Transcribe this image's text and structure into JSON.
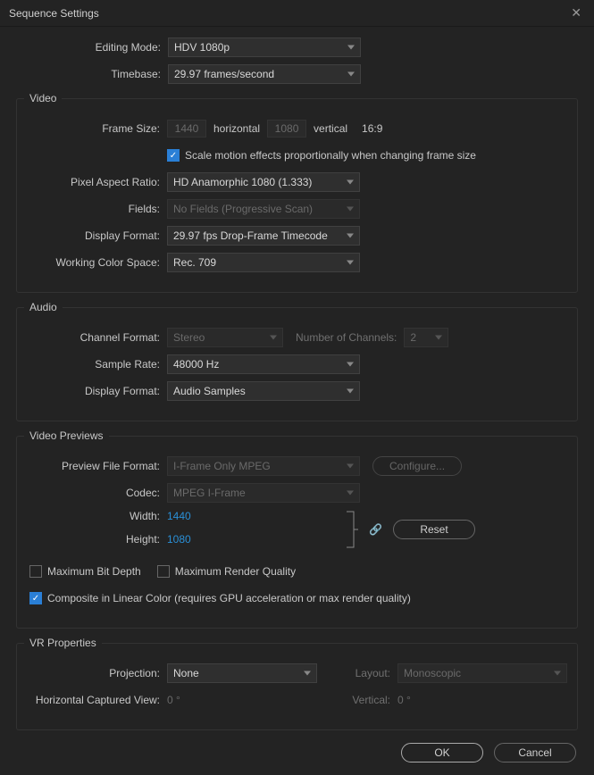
{
  "title": "Sequence Settings",
  "close_glyph": "✕",
  "top": {
    "editing_mode_label": "Editing Mode:",
    "editing_mode_value": "HDV 1080p",
    "timebase_label": "Timebase:",
    "timebase_value": "29.97  frames/second"
  },
  "video": {
    "section_title": "Video",
    "frame_size_label": "Frame Size:",
    "frame_w": "1440",
    "horizontal": "horizontal",
    "frame_h": "1080",
    "vertical": "vertical",
    "aspect": "16:9",
    "scale_motion": "Scale motion effects proportionally when changing frame size",
    "par_label": "Pixel Aspect Ratio:",
    "par_value": "HD Anamorphic 1080 (1.333)",
    "fields_label": "Fields:",
    "fields_value": "No Fields (Progressive Scan)",
    "display_format_label": "Display Format:",
    "display_format_value": "29.97 fps Drop-Frame Timecode",
    "wcs_label": "Working Color Space:",
    "wcs_value": "Rec. 709"
  },
  "audio": {
    "section_title": "Audio",
    "channel_format_label": "Channel Format:",
    "channel_format_value": "Stereo",
    "num_channels_label": "Number of Channels:",
    "num_channels_value": "2",
    "sample_rate_label": "Sample Rate:",
    "sample_rate_value": "48000 Hz",
    "display_format_label": "Display Format:",
    "display_format_value": "Audio Samples"
  },
  "previews": {
    "section_title": "Video Previews",
    "pff_label": "Preview File Format:",
    "pff_value": "I-Frame Only MPEG",
    "configure_label": "Configure...",
    "codec_label": "Codec:",
    "codec_value": "MPEG I-Frame",
    "width_label": "Width:",
    "width_value": "1440",
    "height_label": "Height:",
    "height_value": "1080",
    "reset_label": "Reset",
    "max_bit_depth": "Maximum Bit Depth",
    "max_render_quality": "Maximum Render Quality",
    "composite_linear": "Composite in Linear Color (requires GPU acceleration or max render quality)"
  },
  "vr": {
    "section_title": "VR Properties",
    "projection_label": "Projection:",
    "projection_value": "None",
    "layout_label": "Layout:",
    "layout_value": "Monoscopic",
    "hcv_label": "Horizontal Captured View:",
    "hcv_value": "0 °",
    "vertical_label": "Vertical:",
    "vertical_value": "0 °"
  },
  "footer": {
    "ok": "OK",
    "cancel": "Cancel"
  },
  "icons": {
    "check": "✓",
    "link": "🔗"
  }
}
